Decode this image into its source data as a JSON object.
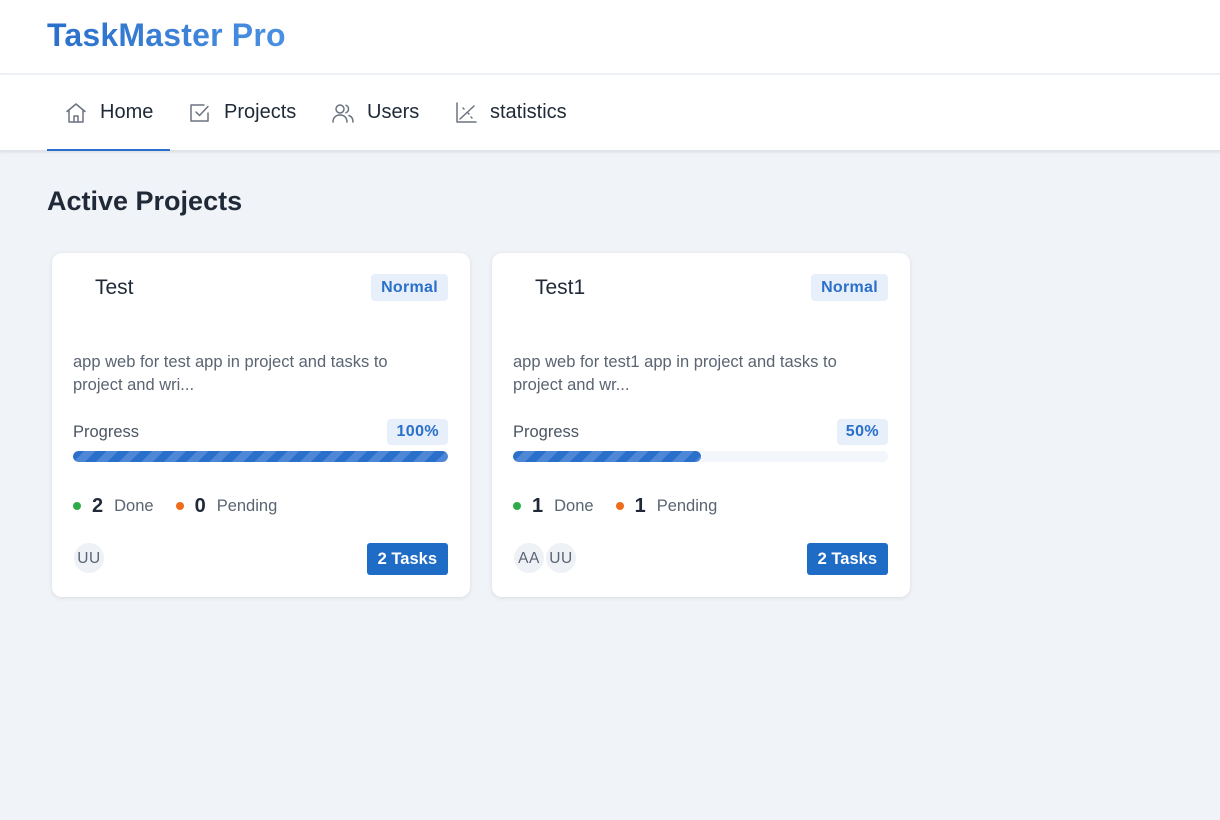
{
  "app": {
    "title": "TaskMaster Pro"
  },
  "nav": {
    "tabs": [
      {
        "label": "Home",
        "icon": "home-icon",
        "active": true
      },
      {
        "label": "Projects",
        "icon": "checkbox-icon",
        "active": false
      },
      {
        "label": "Users",
        "icon": "users-icon",
        "active": false
      },
      {
        "label": "statistics",
        "icon": "chart-icon",
        "active": false
      }
    ]
  },
  "main": {
    "title": "Active Projects",
    "projects": [
      {
        "name": "Test",
        "priority": "Normal",
        "description": "app web for test app in project and tasks to project and wri...",
        "progress_label": "Progress",
        "progress_text": "100%",
        "progress": 1.0,
        "done_count": "2",
        "done_label": "Done",
        "pending_count": "0",
        "pending_label": "Pending",
        "avatars": [
          "UU"
        ],
        "tasks_label": "2 Tasks"
      },
      {
        "name": "Test1",
        "priority": "Normal",
        "description": "app web for test1 app in project and tasks to project and wr...",
        "progress_label": "Progress",
        "progress_text": "50%",
        "progress": 0.5,
        "done_count": "1",
        "done_label": "Done",
        "pending_count": "1",
        "pending_label": "Pending",
        "avatars": [
          "AA",
          "UU"
        ],
        "tasks_label": "2 Tasks"
      }
    ]
  },
  "colors": {
    "accent": "#2a6fc9",
    "done": "#2eac4a",
    "pending": "#ee6b1a",
    "background": "#f0f3f8"
  }
}
